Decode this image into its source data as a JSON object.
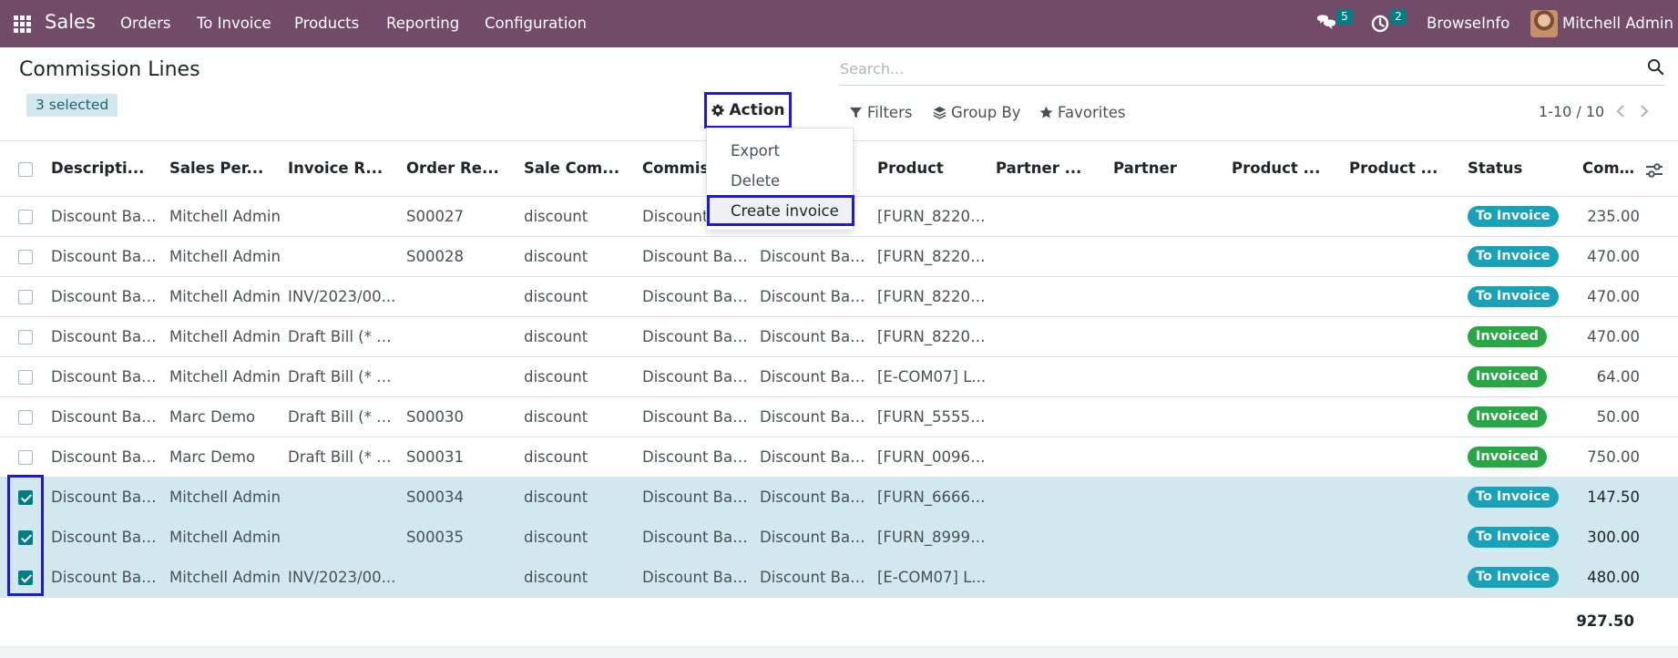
{
  "navbar": {
    "brand": "Sales",
    "menu": [
      "Orders",
      "To Invoice",
      "Products",
      "Reporting",
      "Configuration"
    ],
    "messages_count": "5",
    "activities_count": "2",
    "company": "BrowseInfo",
    "user": "Mitchell Admin"
  },
  "control": {
    "title": "Commission Lines",
    "selected": "3 selected",
    "action_label": "Action",
    "search_placeholder": "Search...",
    "filters": "Filters",
    "group_by": "Group By",
    "favorites": "Favorites",
    "pager": "1-10 / 10"
  },
  "action_menu": {
    "items": [
      "Export",
      "Delete",
      "Create invoice"
    ]
  },
  "table": {
    "headers": [
      "Descripti...",
      "Sales Per...",
      "Invoice R...",
      "Order Re...",
      "Sale Com...",
      "Commiss",
      "",
      "Product",
      "Partner ...",
      "Partner",
      "Product ...",
      "Product ...",
      "Status",
      "Commiss..."
    ],
    "rows": [
      {
        "selected": false,
        "desc": "Discount Bas...",
        "salesperson": "Mitchell Admin",
        "invoice": "",
        "order": "S00027",
        "sale_com": "discount",
        "commiss": "Discount",
        "based": "ed",
        "product": "[FURN_8220]...",
        "status": "To Invoice",
        "amount": "235.00"
      },
      {
        "selected": false,
        "desc": "Discount Bas...",
        "salesperson": "Mitchell Admin",
        "invoice": "",
        "order": "S00028",
        "sale_com": "discount",
        "commiss": "Discount Bas...",
        "based": "Discount Based",
        "product": "[FURN_8220]...",
        "status": "To Invoice",
        "amount": "470.00"
      },
      {
        "selected": false,
        "desc": "Discount Bas...",
        "salesperson": "Mitchell Admin",
        "invoice": "INV/2023/00...",
        "order": "",
        "sale_com": "discount",
        "commiss": "Discount Bas...",
        "based": "Discount Based",
        "product": "[FURN_8220]...",
        "status": "To Invoice",
        "amount": "470.00"
      },
      {
        "selected": false,
        "desc": "Discount Bas...",
        "salesperson": "Mitchell Admin",
        "invoice": "Draft Bill (* 22)",
        "order": "",
        "sale_com": "discount",
        "commiss": "Discount Bas...",
        "based": "Discount Based",
        "product": "[FURN_8220]...",
        "status": "Invoiced",
        "amount": "470.00"
      },
      {
        "selected": false,
        "desc": "Discount Bas...",
        "salesperson": "Mitchell Admin",
        "invoice": "Draft Bill (* 23)",
        "order": "",
        "sale_com": "discount",
        "commiss": "Discount Bas...",
        "based": "Discount Based",
        "product": "[E-COM07] L...",
        "status": "Invoiced",
        "amount": "64.00"
      },
      {
        "selected": false,
        "desc": "Discount Bas...",
        "salesperson": "Marc Demo",
        "invoice": "Draft Bill (* 24)",
        "order": "S00030",
        "sale_com": "discount",
        "commiss": "Discount Bas...",
        "based": "Discount Based",
        "product": "[FURN_5555]...",
        "status": "Invoiced",
        "amount": "50.00"
      },
      {
        "selected": false,
        "desc": "Discount Bas...",
        "salesperson": "Marc Demo",
        "invoice": "Draft Bill (* 25)",
        "order": "S00031",
        "sale_com": "discount",
        "commiss": "Discount Bas...",
        "based": "Discount Based",
        "product": "[FURN_0096]...",
        "status": "Invoiced",
        "amount": "750.00"
      },
      {
        "selected": true,
        "desc": "Discount Bas...",
        "salesperson": "Mitchell Admin",
        "invoice": "",
        "order": "S00034",
        "sale_com": "discount",
        "commiss": "Discount Bas...",
        "based": "Discount Based",
        "product": "[FURN_6666]...",
        "status": "To Invoice",
        "amount": "147.50"
      },
      {
        "selected": true,
        "desc": "Discount Bas...",
        "salesperson": "Mitchell Admin",
        "invoice": "",
        "order": "S00035",
        "sale_com": "discount",
        "commiss": "Discount Bas...",
        "based": "Discount Based",
        "product": "[FURN_8999]...",
        "status": "To Invoice",
        "amount": "300.00"
      },
      {
        "selected": true,
        "desc": "Discount Bas...",
        "salesperson": "Mitchell Admin",
        "invoice": "INV/2023/00...",
        "order": "",
        "sale_com": "discount",
        "commiss": "Discount Bas...",
        "based": "Discount Based",
        "product": "[E-COM07] L...",
        "status": "To Invoice",
        "amount": "480.00"
      }
    ],
    "total": "927.50"
  },
  "colors": {
    "navbar": "#714b67",
    "accent": "#017e84",
    "to_invoice": "#17a2b8",
    "invoiced": "#28a745",
    "highlight": "#1d18e0"
  }
}
